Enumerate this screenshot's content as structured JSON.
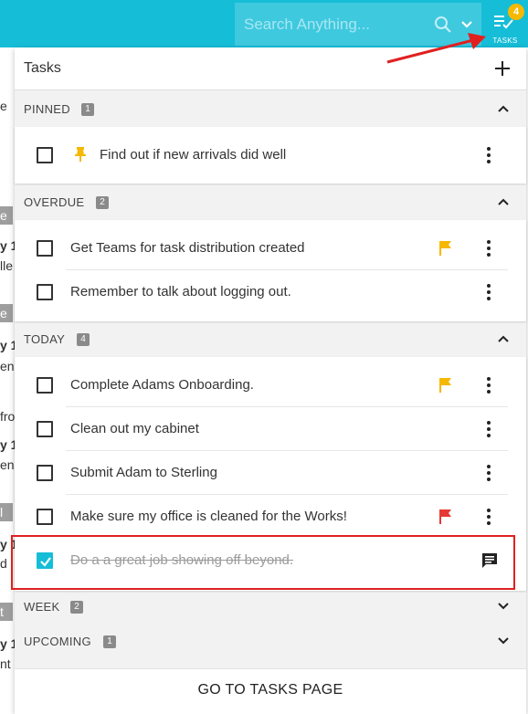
{
  "header": {
    "search_placeholder": "Search Anything...",
    "tasks_label": "TASKS",
    "tasks_badge": "4"
  },
  "panel": {
    "title": "Tasks",
    "footer_link": "GO TO TASKS PAGE"
  },
  "sections": {
    "pinned": {
      "title": "PINNED",
      "count": "1",
      "tasks": [
        {
          "text": "Find out if new arrivals did well"
        }
      ]
    },
    "overdue": {
      "title": "OVERDUE",
      "count": "2",
      "tasks": [
        {
          "text": "Get Teams for task distribution created",
          "flag": "#f6b800"
        },
        {
          "text": "Remember to talk about logging out."
        }
      ]
    },
    "today": {
      "title": "TODAY",
      "count": "4",
      "tasks": [
        {
          "text": "Complete Adams Onboarding.",
          "flag": "#f6b800"
        },
        {
          "text": "Clean out my cabinet"
        },
        {
          "text": "Submit Adam to Sterling"
        },
        {
          "text": "Make sure my office is cleaned for the Works!",
          "flag": "#e53935"
        },
        {
          "text": "Do a a great job showing off beyond.",
          "completed": true
        }
      ]
    },
    "week": {
      "title": "WEEK",
      "count": "2"
    },
    "upcoming": {
      "title": "UPCOMING",
      "count": "1"
    }
  },
  "background_fragments": {
    "f1": "e",
    "f2": "y 1",
    "f3": "lle",
    "f4": "y 1",
    "f5": "en",
    "f6": "fro",
    "f7": "y 1",
    "f8": "en",
    "f9": "y 1",
    "f10": "d",
    "f11": "y 1",
    "f12": "nt"
  },
  "colors": {
    "accent": "#16bdd7",
    "badge": "#f6b800",
    "flag_yellow": "#f6b800",
    "flag_red": "#e53935",
    "annotation_red": "#e02020"
  }
}
